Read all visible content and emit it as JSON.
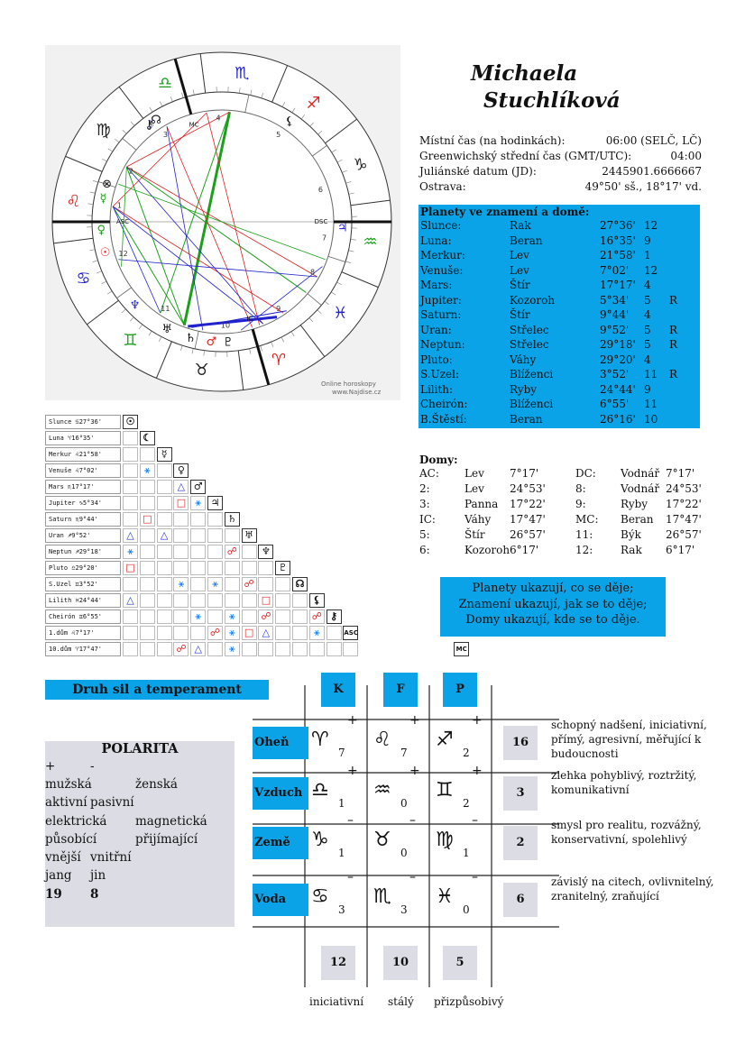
{
  "name": {
    "first": "Michaela",
    "last": "Stuchlíková"
  },
  "info": [
    {
      "label": "Místní čas (na hodinkách):",
      "value": "06:00  (SELČ, LČ)"
    },
    {
      "label": "Greenwichský střední čas (GMT/UTC):",
      "value": "04:00"
    },
    {
      "label": "Juliánské datum (JD):",
      "value": "2445901.6666667"
    },
    {
      "label": "Ostrava:",
      "value": "49°50' sš., 18°17' vd."
    }
  ],
  "planets_title": "Planety ve znamení a domě:",
  "planets": [
    {
      "name": "Slunce:",
      "sign": "Rak",
      "deg": "27°36'",
      "house": "12",
      "r": ""
    },
    {
      "name": "Luna:",
      "sign": "Beran",
      "deg": "16°35'",
      "house": "9",
      "r": ""
    },
    {
      "name": "Merkur:",
      "sign": "Lev",
      "deg": "21°58'",
      "house": "1",
      "r": ""
    },
    {
      "name": "Venuše:",
      "sign": "Lev",
      "deg": "7°02'",
      "house": "12",
      "r": ""
    },
    {
      "name": "Mars:",
      "sign": "Štír",
      "deg": "17°17'",
      "house": "4",
      "r": ""
    },
    {
      "name": "Jupiter:",
      "sign": "Kozoroh",
      "deg": "5°34'",
      "house": "5",
      "r": "R"
    },
    {
      "name": "Saturn:",
      "sign": "Štír",
      "deg": "9°44'",
      "house": "4",
      "r": ""
    },
    {
      "name": "Uran:",
      "sign": "Střelec",
      "deg": "9°52'",
      "house": "5",
      "r": "R"
    },
    {
      "name": "Neptun:",
      "sign": "Střelec",
      "deg": "29°18'",
      "house": "5",
      "r": "R"
    },
    {
      "name": "Pluto:",
      "sign": "Váhy",
      "deg": "29°20'",
      "house": "4",
      "r": ""
    },
    {
      "name": "S.Uzel:",
      "sign": "Blíženci",
      "deg": "3°52'",
      "house": "11",
      "r": "R"
    },
    {
      "name": "Lilith:",
      "sign": "Ryby",
      "deg": "24°44'",
      "house": "9",
      "r": ""
    },
    {
      "name": "Cheirón:",
      "sign": "Blíženci",
      "deg": "6°55'",
      "house": "11",
      "r": ""
    },
    {
      "name": "B.Štěstí:",
      "sign": "Beran",
      "deg": "26°16'",
      "house": "10",
      "r": ""
    }
  ],
  "houses_title": "Domy:",
  "houses_left": [
    {
      "h": "AC:",
      "sign": "Lev",
      "deg": "7°17'"
    },
    {
      "h": "2:",
      "sign": "Lev",
      "deg": "24°53'"
    },
    {
      "h": "3:",
      "sign": "Panna",
      "deg": "17°22'"
    },
    {
      "h": "IC:",
      "sign": "Váhy",
      "deg": "17°47'"
    },
    {
      "h": "5:",
      "sign": "Štír",
      "deg": "26°57'"
    },
    {
      "h": "6:",
      "sign": "Kozoroh",
      "deg": "6°17'"
    }
  ],
  "houses_right": [
    {
      "h": "DC:",
      "sign": "Vodnář",
      "deg": "7°17'"
    },
    {
      "h": "8:",
      "sign": "Vodnář",
      "deg": "24°53'"
    },
    {
      "h": "9:",
      "sign": "Ryby",
      "deg": "17°22'"
    },
    {
      "h": "MC:",
      "sign": "Beran",
      "deg": "17°47'"
    },
    {
      "h": "11:",
      "sign": "Býk",
      "deg": "26°57'"
    },
    {
      "h": "12:",
      "sign": "Rak",
      "deg": "6°17'"
    }
  ],
  "quote": [
    "Planety ukazují, co se děje;",
    "Znamení ukazují, jak se to děje;",
    "Domy ukazují, kde se to děje."
  ],
  "watermark": [
    "Online horoskopy",
    "www.Najdise.cz"
  ],
  "wheel": {
    "mc": "MC",
    "ic": "IC",
    "asc": "ASC",
    "dsc": "DSC",
    "house_numbers": [
      "1",
      "2",
      "3",
      "4",
      "5",
      "6",
      "7",
      "8",
      "9",
      "10",
      "11",
      "12"
    ]
  },
  "aspect_labels": [
    "Slunce ♋27°36'",
    "Luna ♈16°35'",
    "Merkur ♌21°58'",
    "Venuše ♌7°02'",
    "Mars ♏17°17'",
    "Jupiter ♑5°34'",
    "Saturn ♏9°44'",
    "Uran ♐9°52'",
    "Neptun ♐29°18'",
    "Pluto ♎29°20'",
    "S.Uzel ♊3°52'",
    "Lilith ♓24°44'",
    "Cheirón ♊6°55'",
    "1.dům ♌7°17'",
    "10.dům ♈17°47'"
  ],
  "aspect_diag": [
    "☉",
    "☾",
    "☿",
    "♀",
    "♂",
    "♃",
    "♄",
    "♅",
    "♆",
    "♇",
    "☊",
    "⚸",
    "⚷",
    "ASC",
    "MC"
  ],
  "druh_title": "Druh sil a temperament",
  "polarita": {
    "title": "POLARITA",
    "plus": "+",
    "minus": "-",
    "rows": [
      [
        "mužská",
        "ženská"
      ],
      [
        "aktivní",
        "pasivní"
      ],
      [
        "elektrická",
        "magnetická"
      ],
      [
        "působící",
        "přijímající"
      ],
      [
        "vnější",
        "vnitřní"
      ],
      [
        "jang",
        "jin"
      ]
    ],
    "plus_total": "19",
    "minus_total": "8"
  },
  "cols": [
    "K",
    "F",
    "P"
  ],
  "elements": [
    {
      "name": "Oheň",
      "signs": [
        "♈",
        "♌",
        "♐"
      ],
      "pm": [
        "+",
        "+",
        "+"
      ],
      "counts": [
        "7",
        "7",
        "2"
      ],
      "total": "16",
      "desc": "schopný nadšení, iniciativní, přímý, agresivní, měřující k budoucnosti"
    },
    {
      "name": "Vzduch",
      "signs": [
        "♎",
        "♒",
        "♊"
      ],
      "pm": [
        "+",
        "+",
        "+"
      ],
      "counts": [
        "1",
        "0",
        "2"
      ],
      "total": "3",
      "desc": "zlehka pohyblivý, roztržitý, komunikativní"
    },
    {
      "name": "Země",
      "signs": [
        "♑",
        "♉",
        "♍"
      ],
      "pm": [
        "–",
        "–",
        "–"
      ],
      "counts": [
        "1",
        "0",
        "1"
      ],
      "total": "2",
      "desc": "smysl pro realitu, rozvážný, konservativní, spolehlivý"
    },
    {
      "name": "Voda",
      "signs": [
        "♋",
        "♏",
        "♓"
      ],
      "pm": [
        "–",
        "–",
        "–"
      ],
      "counts": [
        "3",
        "3",
        "0"
      ],
      "total": "6",
      "desc": "závislý na citech, ovlivnitelný, zranitelný, zraňující"
    }
  ],
  "col_totals": [
    "12",
    "10",
    "5"
  ],
  "col_labels": [
    "iniciativní",
    "stálý",
    "přizpůsobivý"
  ],
  "colors": {
    "accent": "#0aa3e8",
    "panel": "#dcdde4"
  }
}
